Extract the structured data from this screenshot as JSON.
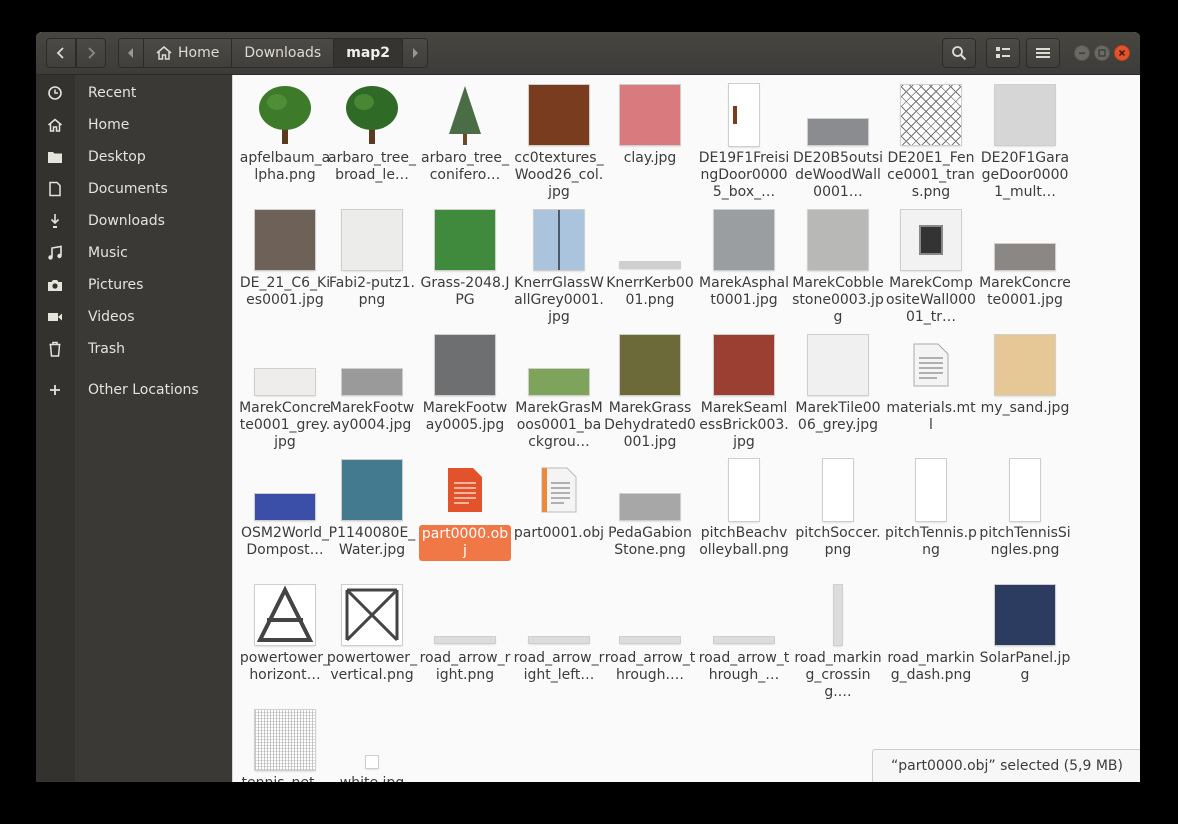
{
  "header": {
    "breadcrumbs": [
      "Home",
      "Downloads",
      "map2"
    ],
    "home_icon": "home-icon",
    "search_icon": "search-icon",
    "view_icon": "list-view-icon",
    "menu_icon": "hamburger-menu-icon"
  },
  "sidebar": {
    "items": [
      {
        "label": "Recent",
        "icon": "clock-icon"
      },
      {
        "label": "Home",
        "icon": "home-icon"
      },
      {
        "label": "Desktop",
        "icon": "folder-icon"
      },
      {
        "label": "Documents",
        "icon": "document-icon"
      },
      {
        "label": "Downloads",
        "icon": "download-icon"
      },
      {
        "label": "Music",
        "icon": "music-icon"
      },
      {
        "label": "Pictures",
        "icon": "camera-icon"
      },
      {
        "label": "Videos",
        "icon": "video-icon"
      },
      {
        "label": "Trash",
        "icon": "trash-icon"
      },
      {
        "label": "Other Locations",
        "icon": "plus-icon"
      }
    ]
  },
  "files": [
    {
      "name": "apfelbaum​_alpha.png",
      "kind": "tree",
      "color": "#3d7a2a"
    },
    {
      "name": "arbaro_​tree_​broad_le…",
      "kind": "tree",
      "color": "#2f6b26"
    },
    {
      "name": "arbaro_​tree_​conifero…",
      "kind": "conifer",
      "color": "#4b6d45"
    },
    {
      "name": "cc0textures​_Wood26_​col.jpg",
      "kind": "square",
      "color": "#7a3c1e"
    },
    {
      "name": "clay.jpg",
      "kind": "square",
      "color": "#d97a7e"
    },
    {
      "name": "DE19F1Frei​singDoor00​005_box_…",
      "kind": "tall",
      "color": "#ffffff"
    },
    {
      "name": "DE20B5out​sideWood​Wall0001…",
      "kind": "strip",
      "color": "#8a8c8f"
    },
    {
      "name": "DE20E1_​Fence0001_​trans.png",
      "kind": "fence",
      "color": "#ffffff"
    },
    {
      "name": "DE20F1Gar​ageDoor00​001_mult…",
      "kind": "square",
      "color": "#d6d6d6"
    },
    {
      "name": "DE_21_C6_​Kies0001.​jpg",
      "kind": "square",
      "color": "#6e6158"
    },
    {
      "name": "Fabi2-​putz1.png",
      "kind": "square",
      "color": "#ececea"
    },
    {
      "name": "Grass-2048.​JPG",
      "kind": "square",
      "color": "#3f8a3c"
    },
    {
      "name": "KnerrGlass​WallGrey00​01.jpg",
      "kind": "glass",
      "color": "#a9c4dc"
    },
    {
      "name": "KnerrKerb0​001.png",
      "kind": "line",
      "color": "#cfcfcf"
    },
    {
      "name": "MarekAsph​alt0001.jpg",
      "kind": "square",
      "color": "#9b9ea1"
    },
    {
      "name": "MarekCobb​lestone000​3.jpg",
      "kind": "square",
      "color": "#b8b9b7"
    },
    {
      "name": "MarekCom​positeWall​00001_tr…",
      "kind": "window",
      "color": "#f2f2f2"
    },
    {
      "name": "MarekConc​rete0001.​jpg",
      "kind": "strip",
      "color": "#8a8785"
    },
    {
      "name": "MarekConc​rete0001_​grey.jpg",
      "kind": "strip",
      "color": "#efecec"
    },
    {
      "name": "MarekFoot​way0004.​jpg",
      "kind": "strip",
      "color": "#9a9a9a"
    },
    {
      "name": "MarekFoot​way0005.​jpg",
      "kind": "square",
      "color": "#6d6f70"
    },
    {
      "name": "MarekGras​Moos0001_​backgrou…",
      "kind": "strip",
      "color": "#7ea35a"
    },
    {
      "name": "MarekGras​sDehydrate​d0001.jpg",
      "kind": "square",
      "color": "#6d6a3a"
    },
    {
      "name": "MarekSea​mlessBrick​003.jpg",
      "kind": "square",
      "color": "#9a3f32"
    },
    {
      "name": "MarekTile0​006_grey.​jpg",
      "kind": "square",
      "color": "#f0f0f0"
    },
    {
      "name": "materials.​mtl",
      "kind": "doc",
      "color": "#e6e6e6"
    },
    {
      "name": "my_sand.​jpg",
      "kind": "square",
      "color": "#e6c896"
    },
    {
      "name": "OSM2Worl​d_​Dompost…",
      "kind": "strip",
      "color": "#3b4fa8"
    },
    {
      "name": "P1140080E​_Water.jpg",
      "kind": "square",
      "color": "#447a8f"
    },
    {
      "name": "part0000.​obj",
      "kind": "objred",
      "color": "#e2532c",
      "selected": true
    },
    {
      "name": "part0001.​obj",
      "kind": "objdoc",
      "color": "#e98a3e"
    },
    {
      "name": "PedaGabio​nStone.png",
      "kind": "strip",
      "color": "#a7a7a7"
    },
    {
      "name": "pitchBeach​volleyball.​png",
      "kind": "tall",
      "color": "#ffffff"
    },
    {
      "name": "pitchSoccer​.png",
      "kind": "tall",
      "color": "#ffffff"
    },
    {
      "name": "pitchTennis​.png",
      "kind": "tall",
      "color": "#ffffff"
    },
    {
      "name": "pitchTennis​Singles.png",
      "kind": "tall",
      "color": "#ffffff"
    },
    {
      "name": "powertowe​r_​horizont…",
      "kind": "towerA",
      "color": "#444444"
    },
    {
      "name": "powertowe​r_vertical.​png",
      "kind": "towerX",
      "color": "#444444"
    },
    {
      "name": "road_​arrow_​right.png",
      "kind": "line",
      "color": "#dcdcdc"
    },
    {
      "name": "road_​arrow_​right_left…",
      "kind": "line",
      "color": "#dcdcdc"
    },
    {
      "name": "road_​arrow_​through.…",
      "kind": "line",
      "color": "#dcdcdc"
    },
    {
      "name": "road_​arrow_​through_…",
      "kind": "line",
      "color": "#dcdcdc"
    },
    {
      "name": "road_​marking_​crossing.…",
      "kind": "vline",
      "color": "#dcdcdc"
    },
    {
      "name": "road_​marking_​dash.png",
      "kind": "none",
      "color": "#ffffff"
    },
    {
      "name": "SolarPanel.​jpg",
      "kind": "square",
      "color": "#2c3c60"
    },
    {
      "name": "tennis_net…",
      "kind": "net",
      "color": "#c9c9c9"
    },
    {
      "name": "white.jpg",
      "kind": "small",
      "color": "#ffffff"
    }
  ],
  "status": "“part0000.obj” selected  (5,9 MB)",
  "colors": {
    "accent": "#f07746",
    "close": "#e2532c"
  }
}
